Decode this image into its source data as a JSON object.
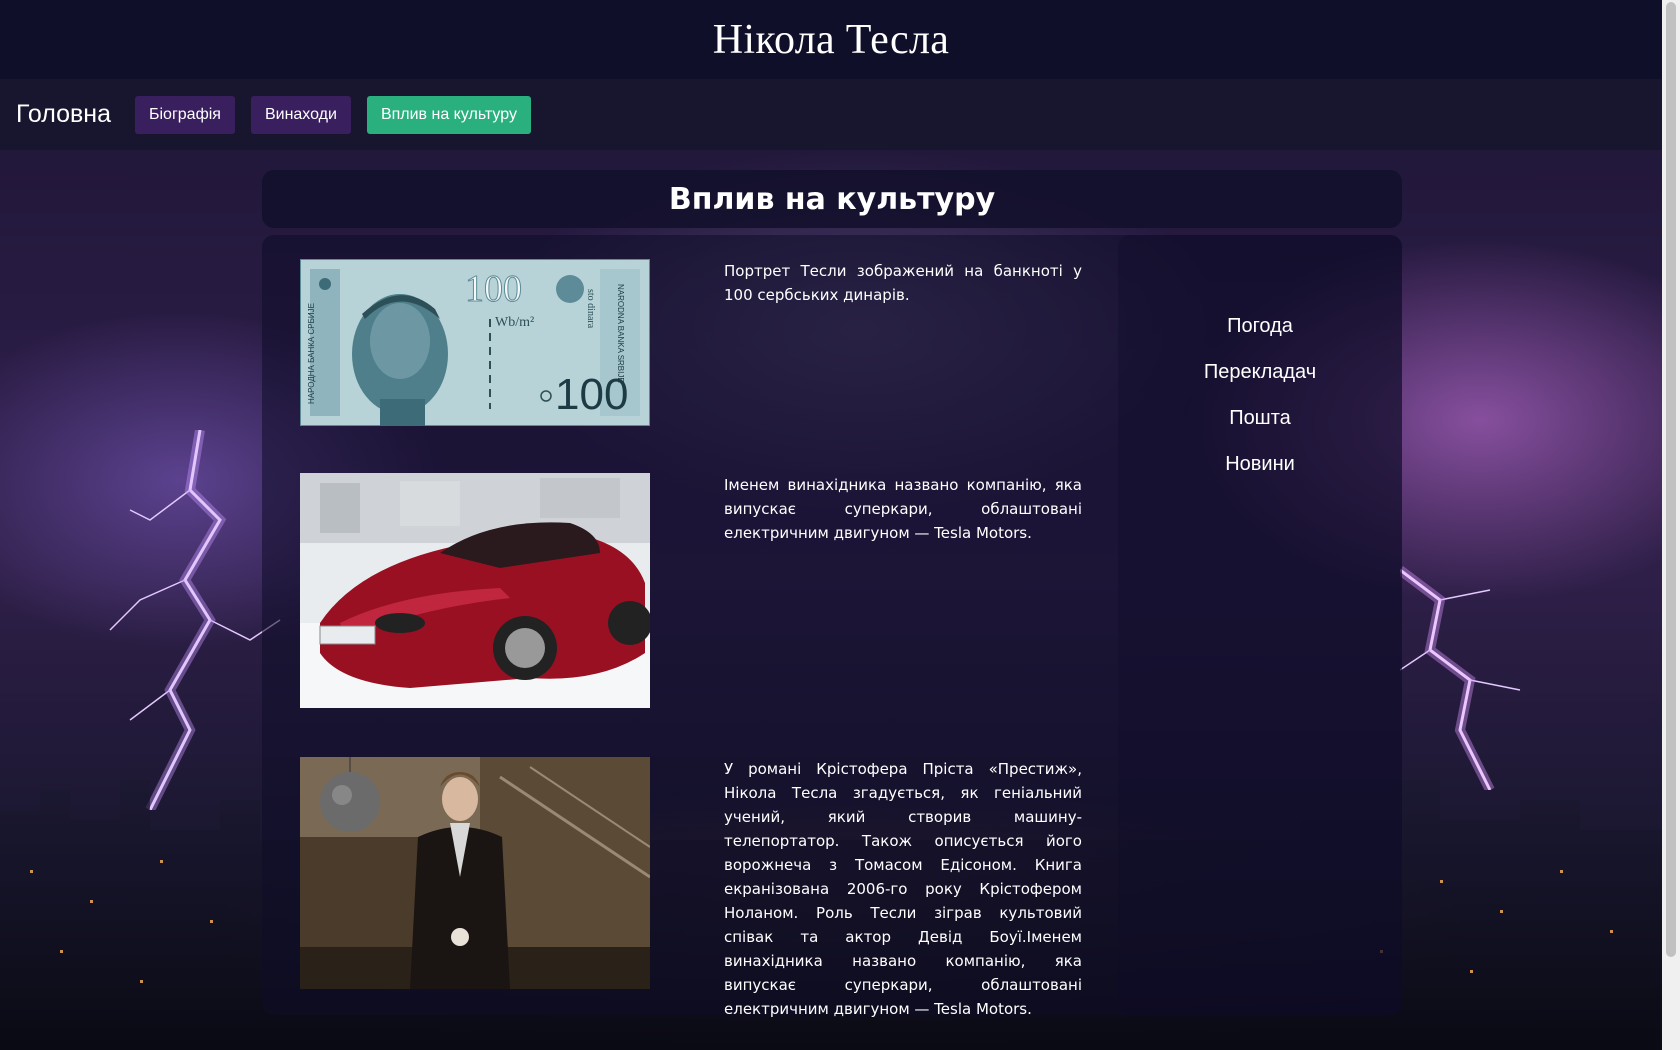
{
  "site": {
    "title": "Нікола Тесла"
  },
  "nav": {
    "home": "Головна",
    "items": [
      {
        "label": "Біографія",
        "active": false
      },
      {
        "label": "Винаходи",
        "active": false
      },
      {
        "label": "Вплив на культуру",
        "active": true
      }
    ]
  },
  "page": {
    "heading": "Вплив на культуру"
  },
  "sections": [
    {
      "image": "banknote-100-dinars",
      "text": "Портрет Тесли зображений на банкноті у 100 сербських динарів."
    },
    {
      "image": "tesla-roadster",
      "text": "Іменем винахідника названо компанію, яка випускає суперкари, облаштовані електричним двигуном — Tesla Motors."
    },
    {
      "image": "prestige-still",
      "text": "У романі Крістофера Пріста «Престиж», Нікола Тесла згадується, як геніальний учений, який створив машину-телепортатор. Також описується його ворожнеча з Томасом Едісоном. Книга екранізована 2006-го року Крістофером Ноланом. Роль Тесли зіграв культовий співак та актор Девід Боуї.Іменем винахідника названо компанію, яка випускає суперкари, облаштовані електричним двигуном — Tesla Motors."
    }
  ],
  "banknote": {
    "value": "100",
    "left_text": "НАРОДНА БАНКА СРБИЈЕ",
    "right_text": "NARODNA BANKA SRBIJE",
    "denomination_text": "sto dinara",
    "formula": "Wb/m²"
  },
  "sidebar": {
    "links": [
      "Погода",
      "Перекладач",
      "Пошта",
      "Новини"
    ]
  },
  "colors": {
    "header": "#0f0f29",
    "navbar": "#18162f",
    "button": "#3a1f5e",
    "button_active": "#29b07e"
  }
}
